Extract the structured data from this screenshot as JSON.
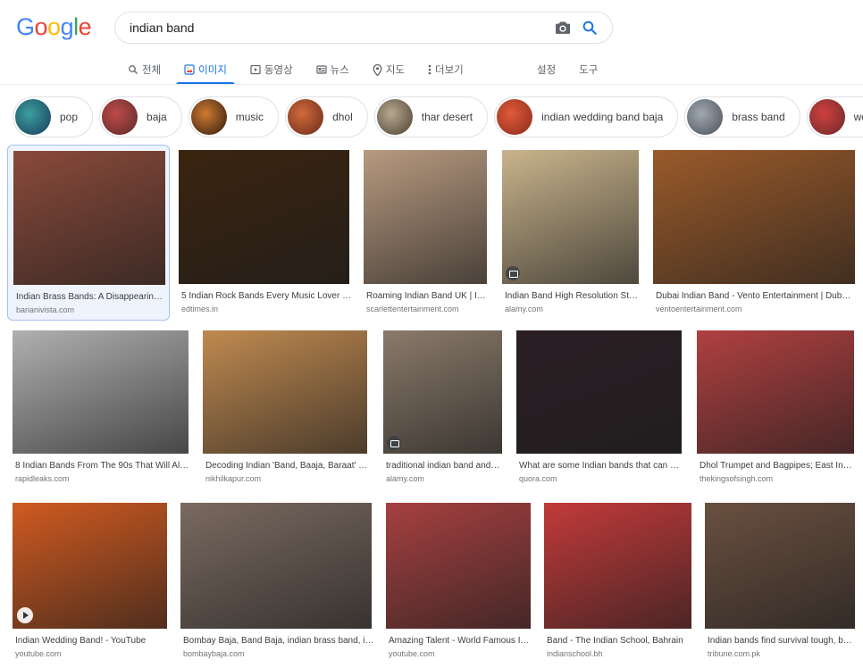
{
  "logo": [
    "G",
    "o",
    "o",
    "g",
    "l",
    "e"
  ],
  "search": {
    "value": "indian band"
  },
  "tabs": [
    {
      "label": "전체",
      "icon": "search-icon"
    },
    {
      "label": "이미지",
      "icon": "image-icon"
    },
    {
      "label": "동영상",
      "icon": "video-icon"
    },
    {
      "label": "뉴스",
      "icon": "news-icon"
    },
    {
      "label": "지도",
      "icon": "map-pin-icon"
    },
    {
      "label": "더보기",
      "icon": "more-vert-icon"
    }
  ],
  "tools": {
    "settings": "설정",
    "tools": "도구"
  },
  "chips": [
    "pop",
    "baja",
    "music",
    "dhol",
    "thar desert",
    "indian wedding band baja",
    "brass band",
    "wedding"
  ],
  "results": [
    {
      "title": "Indian Brass Bands: A Disappearin…",
      "site": "bananivista.com",
      "bg": "#8a4a3a"
    },
    {
      "title": "5 Indian Rock Bands Every Music Lover …",
      "site": "edtimes.in",
      "bg": "#3a2410"
    },
    {
      "title": "Roaming Indian Band UK | I…",
      "site": "scarlettentertainment.com",
      "bg": "#b89a80"
    },
    {
      "title": "Indian Band High Resolution St…",
      "site": "alamy.com",
      "bg": "#c9b48c"
    },
    {
      "title": "Dubai Indian Band - Vento Entertainment | Duba…",
      "site": "ventoentertainment.com",
      "bg": "#9a5a2a"
    },
    {
      "title": "8 Indian Bands From The 90s That Will Al…",
      "site": "rapidleaks.com",
      "bg": "#b0b0b0"
    },
    {
      "title": "Decoding Indian 'Band, Baaja, Baraat' …",
      "site": "nikhilkapur.com",
      "bg": "#c08a50"
    },
    {
      "title": "traditional indian band and…",
      "site": "alamy.com",
      "bg": "#8a7a6a"
    },
    {
      "title": "What are some Indian bands that can …",
      "site": "quora.com",
      "bg": "#2a1e24"
    },
    {
      "title": "Dhol Trumpet and Bagpipes; East In…",
      "site": "thekingsofsingh.com",
      "bg": "#b04040"
    },
    {
      "title": "Indian Wedding Band! - YouTube",
      "site": "youtube.com",
      "bg": "#d05a20"
    },
    {
      "title": "Bombay Baja, Band Baja, indian brass band, i…",
      "site": "bombaybaja.com",
      "bg": "#7a6a60"
    },
    {
      "title": "Amazing Talent - World Famous I…",
      "site": "youtube.com",
      "bg": "#a64040"
    },
    {
      "title": "Band - The Indian School, Bahrain",
      "site": "indianschool.bh",
      "bg": "#c23a3a"
    },
    {
      "title": "Indian bands find survival tough, b…",
      "site": "tribune.com.pk",
      "bg": "#6a5040"
    }
  ]
}
